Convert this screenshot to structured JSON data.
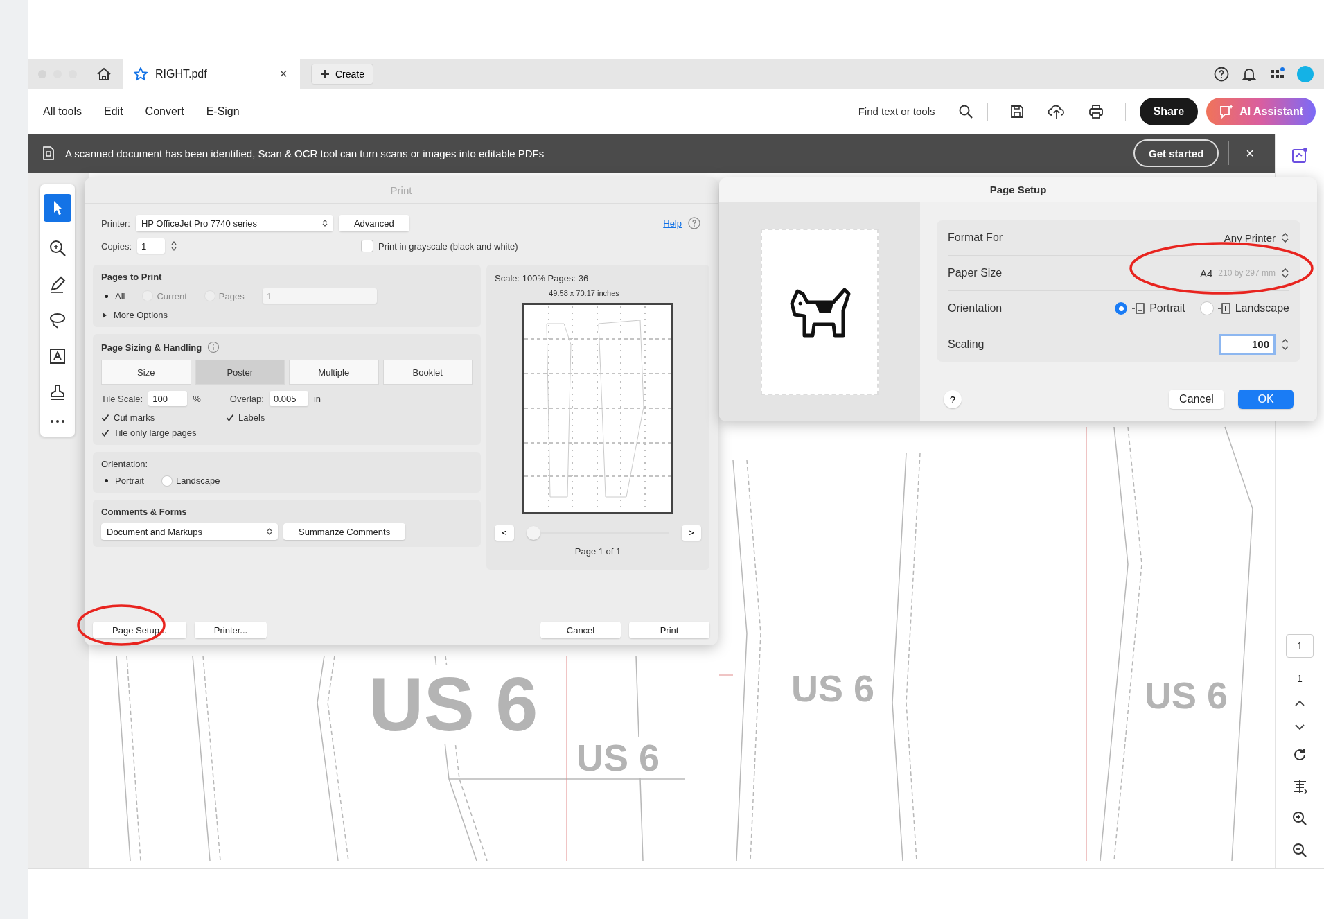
{
  "tabs": [
    {
      "label": "RIGHT.pdf",
      "selected": true,
      "close": "×"
    }
  ],
  "new_tab": "Create",
  "menu": [
    "All tools",
    "Edit",
    "Convert",
    "E-Sign"
  ],
  "search": {
    "placeholder": "Find text or tools"
  },
  "share": "Share",
  "ai_assistant": "AI Assistant",
  "banner": {
    "message": "A scanned document has been identified, Scan & OCR tool can turn scans or images into editable PDFs",
    "action": "Get started",
    "close": "×"
  },
  "document": {
    "labels": [
      "US 6",
      "US 6",
      "US 6",
      "US 6"
    ]
  },
  "print_dialog": {
    "title": "Print",
    "printer": {
      "label": "Printer:",
      "value": "HP OfficeJet Pro 7740 series"
    },
    "advanced": "Advanced",
    "help": "Help",
    "copies": {
      "label": "Copies:",
      "value": "1"
    },
    "grayscale": {
      "label": "Print in grayscale (black and white)",
      "checked": false
    },
    "pages_to_print": {
      "title": "Pages to Print",
      "options": [
        {
          "label": "All",
          "selected": true,
          "disabled": false
        },
        {
          "label": "Current",
          "selected": false,
          "disabled": true
        },
        {
          "label": "Pages",
          "selected": false,
          "disabled": true
        }
      ],
      "pages_value": "1",
      "more_options": "More Options",
      "expanded": false
    },
    "sizing": {
      "title": "Page Sizing & Handling",
      "modes": [
        {
          "label": "Size",
          "selected": false
        },
        {
          "label": "Poster",
          "selected": true
        },
        {
          "label": "Multiple",
          "selected": false
        },
        {
          "label": "Booklet",
          "selected": false
        }
      ],
      "tile_scale": {
        "label": "Tile Scale:",
        "value": "100",
        "unit": "%"
      },
      "overlap": {
        "label": "Overlap:",
        "value": "0.005",
        "unit": "in"
      },
      "checks": [
        {
          "label": "Cut marks",
          "checked": true
        },
        {
          "label": "Labels",
          "checked": true
        },
        {
          "label": "Tile only large pages",
          "checked": true
        }
      ]
    },
    "orientation": {
      "title": "Orientation:",
      "options": [
        {
          "label": "Portrait",
          "selected": true
        },
        {
          "label": "Landscape",
          "selected": false
        }
      ]
    },
    "comments": {
      "title": "Comments & Forms",
      "value": "Document and Markups",
      "summarize": "Summarize Comments"
    },
    "preview": {
      "scale": "Scale: 100% Pages: 36",
      "size": "49.58 x 70.17 inches",
      "prev": "<",
      "next": ">",
      "page": "Page 1 of 1"
    },
    "left_buttons": [
      "Page Setup...",
      "Printer..."
    ],
    "right_buttons": [
      "Cancel",
      "Print"
    ]
  },
  "page_setup": {
    "title": "Page Setup",
    "format_for": {
      "label": "Format For",
      "value": "Any Printer"
    },
    "paper_size": {
      "label": "Paper Size",
      "value": "A4",
      "detail": "210 by 297 mm"
    },
    "orientation": {
      "label": "Orientation",
      "options": [
        {
          "label": "Portrait",
          "selected": true
        },
        {
          "label": "Landscape",
          "selected": false
        }
      ]
    },
    "scaling": {
      "label": "Scaling",
      "value": "100"
    },
    "help": "?",
    "cancel": "Cancel",
    "ok": "OK"
  },
  "page_nav": {
    "current": "1",
    "total": "1"
  }
}
